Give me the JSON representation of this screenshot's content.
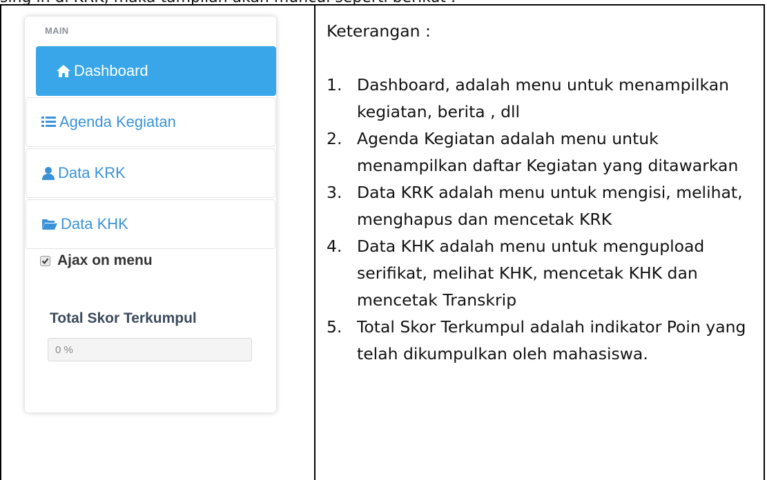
{
  "top_text": "sing in di KRK, maka tampilan akan muncul seperti berikut :",
  "sidebar": {
    "heading": "MAIN",
    "items": [
      {
        "label": "Dashboard",
        "icon": "home-icon",
        "active": true
      },
      {
        "label": "Agenda Kegiatan",
        "icon": "list-icon",
        "active": false
      },
      {
        "label": "Data KRK",
        "icon": "user-icon",
        "active": false
      },
      {
        "label": "Data KHK",
        "icon": "folder-open-icon",
        "active": false
      }
    ],
    "ajax_label": "Ajax on menu",
    "ajax_checked": true,
    "score_title": "Total Skor Terkumpul",
    "score_value": "0 %",
    "score_fraction": 0
  },
  "description": {
    "title": "Keterangan :",
    "items": [
      {
        "num": "1.",
        "text": "Dashboard, adalah menu untuk menampilkan kegiatan, berita , dll"
      },
      {
        "num": "2.",
        "text": "Agenda Kegiatan adalah menu untuk menampilkan daftar Kegiatan yang ditawarkan"
      },
      {
        "num": "3.",
        "text": "Data KRK adalah menu untuk mengisi, melihat, menghapus dan mencetak KRK"
      },
      {
        "num": "4.",
        "text": "Data KHK adalah menu untuk mengupload serifikat, melihat KHK, mencetak KHK dan mencetak Transkrip"
      },
      {
        "num": "5.",
        "text": "Total Skor Terkumpul adalah indikator Poin yang telah dikumpulkan oleh mahasiswa."
      }
    ]
  },
  "colors": {
    "accent": "#38a6e8",
    "link": "#3a92d8"
  }
}
